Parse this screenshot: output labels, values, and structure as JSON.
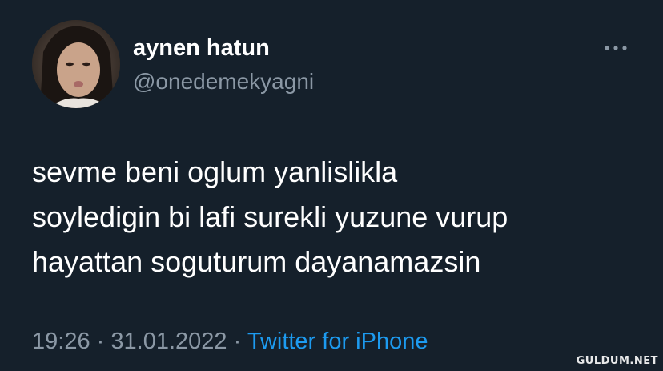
{
  "author": {
    "display_name": "aynen hatun",
    "handle": "@onedemekyagni",
    "avatar_icon": "profile-photo"
  },
  "more_icon": "more-horizontal-icon",
  "tweet": {
    "lines": [
      "sevme beni oglum yanlislikla",
      "soyledigin bi lafi surekli yuzune vurup",
      "hayattan soguturum dayanamazsin"
    ]
  },
  "meta": {
    "time": "19:26",
    "separator": "·",
    "date": "31.01.2022",
    "source": "Twitter for iPhone"
  },
  "watermark": "GULDUM.NET",
  "colors": {
    "background": "#15202b",
    "text": "#ffffff",
    "secondary": "#8b98a5",
    "link": "#1d9bf0"
  }
}
